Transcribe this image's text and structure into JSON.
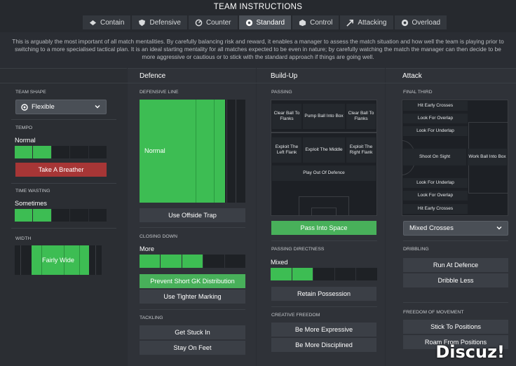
{
  "header": {
    "title": "TEAM INSTRUCTIONS",
    "tabs": [
      {
        "label": "Contain",
        "icon": "contain-icon"
      },
      {
        "label": "Defensive",
        "icon": "defensive-icon"
      },
      {
        "label": "Counter",
        "icon": "counter-icon"
      },
      {
        "label": "Standard",
        "icon": "standard-icon",
        "active": true
      },
      {
        "label": "Control",
        "icon": "control-icon"
      },
      {
        "label": "Attacking",
        "icon": "attacking-icon"
      },
      {
        "label": "Overload",
        "icon": "overload-icon"
      }
    ],
    "description": "This is arguably the most important of all match mentalities. By carefully balancing risk and reward, it enables a manager to assess the match situation and how well the team is playing prior to switching to a more specialised tactical plan. It is an ideal starting mentality for all matches expected to be even in nature; by carefully watching the match the manager can then decide to be more aggressive or cautious or to stick with the standard approach if things are going well."
  },
  "general": {
    "team_shape_label": "TEAM SHAPE",
    "team_shape_value": "Flexible",
    "tempo_label": "TEMPO",
    "tempo_value": "Normal",
    "tempo_level": 2,
    "tempo_steps": 5,
    "tempo_button": "Take A Breather",
    "time_wasting_label": "TIME WASTING",
    "time_wasting_value": "Sometimes",
    "time_wasting_level": 2,
    "time_wasting_steps": 5,
    "width_label": "WIDTH",
    "width_value": "Fairly Wide"
  },
  "defence": {
    "heading": "Defence",
    "defensive_line_label": "DEFENSIVE LINE",
    "defensive_line_value": "Normal",
    "offside_button": "Use Offside Trap",
    "closing_down_label": "CLOSING DOWN",
    "closing_down_value": "More",
    "closing_down_level": 3,
    "closing_down_steps": 5,
    "prevent_gk_button": "Prevent Short GK Distribution",
    "tighter_marking_button": "Use Tighter Marking",
    "tackling_label": "TACKLING",
    "stuck_in_button": "Get Stuck In",
    "stay_feet_button": "Stay On Feet"
  },
  "buildup": {
    "heading": "Build-Up",
    "passing_label": "PASSING",
    "zones": {
      "clear_left": "Clear Ball To Flanks",
      "pump": "Pump Ball Into Box",
      "clear_right": "Clear Ball To Flanks",
      "exploit_left": "Exploit The Left Flank",
      "exploit_middle": "Exploit The Middle",
      "exploit_right": "Exploit The Right Flank",
      "play_out": "Play Out Of Defence"
    },
    "pass_space_button": "Pass Into Space",
    "directness_label": "PASSING DIRECTNESS",
    "directness_value": "Mixed",
    "directness_level": 2,
    "directness_steps": 5,
    "retain_button": "Retain Possession",
    "creative_label": "CREATIVE FREEDOM",
    "expressive_button": "Be More Expressive",
    "disciplined_button": "Be More Disciplined"
  },
  "attack": {
    "heading": "Attack",
    "final_third_label": "FINAL THIRD",
    "zones": {
      "early_top": "Hit Early Crosses",
      "overlap_top": "Look For Overlap",
      "underlap_top": "Look For Underlap",
      "shoot": "Shoot On Sight",
      "work_box": "Work Ball Into Box",
      "underlap_bottom": "Look For Underlap",
      "overlap_bottom": "Look For Overlap",
      "early_bottom": "Hit Early Crosses"
    },
    "crosses_value": "Mixed Crosses",
    "dribbling_label": "DRIBBLING",
    "run_defence_button": "Run At Defence",
    "dribble_less_button": "Dribble Less",
    "freedom_label": "FREEDOM OF MOVEMENT",
    "stick_positions_button": "Stick To Positions",
    "roam_button": "Roam From Positions"
  },
  "watermark": "Discuz!",
  "colors": {
    "accent_green": "#3dbd53",
    "button_red": "#a73636"
  }
}
